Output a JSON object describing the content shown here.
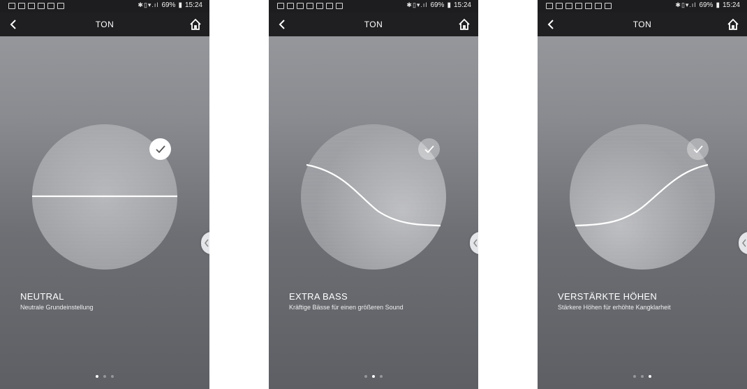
{
  "status": {
    "battery": "69%",
    "time": "15:24"
  },
  "screens": [
    {
      "title": "TON",
      "mode": "NEUTRAL",
      "description": "Neutrale Grundeinstellung",
      "selected": true,
      "curve": "flat",
      "page_dots": {
        "count": 3,
        "active": 1
      }
    },
    {
      "title": "TON",
      "mode": "EXTRA BASS",
      "description": "Kräftige Bässe für einen größeren Sound",
      "selected": false,
      "curve": "bass",
      "page_dots": {
        "count": 3,
        "active": 2
      }
    },
    {
      "title": "TON",
      "mode": "VERSTÄRKTE HÖHEN",
      "description": "Stärkere Höhen für erhöhte Kangklarheit",
      "selected": false,
      "curve": "treble",
      "page_dots": {
        "count": 3,
        "active": 3
      }
    }
  ],
  "icons": {
    "back": "chevron-left-icon",
    "home": "home-icon",
    "check": "checkmark-icon",
    "handle": "chevron-left-icon"
  },
  "colors": {
    "appbar": "#1f1f21",
    "statusbar": "#1d1d1f",
    "accent": "#ffffff"
  }
}
